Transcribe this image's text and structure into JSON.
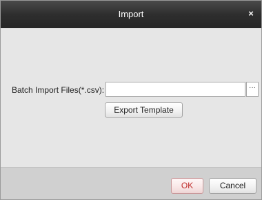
{
  "dialog": {
    "title": "Import",
    "close_symbol": "×"
  },
  "form": {
    "import_label": "Batch Import Files(*.csv):",
    "path_value": "",
    "browse_label": "···",
    "export_template_label": "Export Template"
  },
  "footer": {
    "ok_label": "OK",
    "cancel_label": "Cancel"
  },
  "colors": {
    "titlebar": "#2e2e2e",
    "body": "#e6e6e6",
    "footer": "#d0d0d0",
    "ok_text": "#c0302f"
  }
}
